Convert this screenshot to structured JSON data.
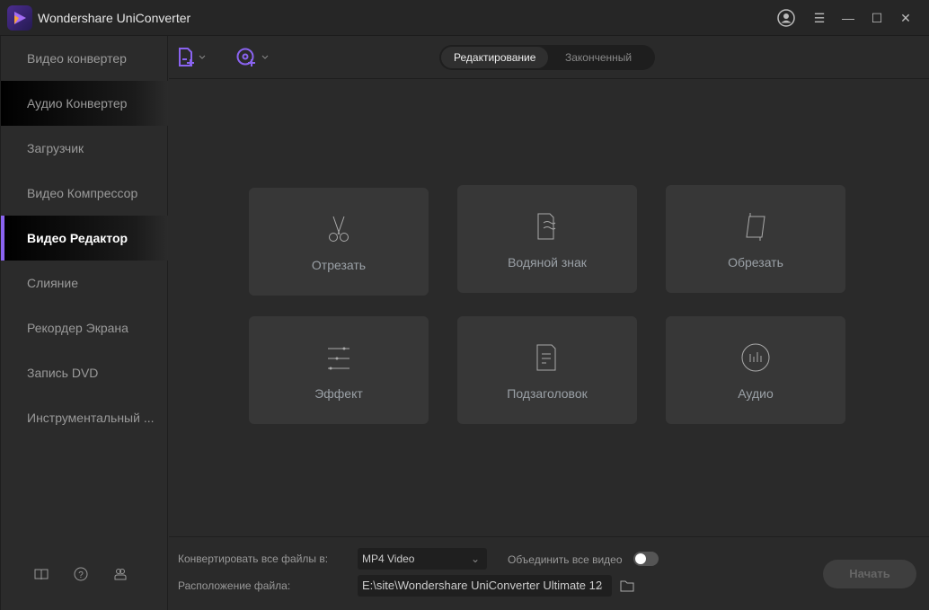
{
  "app": {
    "title": "Wondershare UniConverter"
  },
  "sidebar": {
    "items": [
      {
        "label": "Видео конвертер"
      },
      {
        "label": "Аудио Конвертер"
      },
      {
        "label": "Загрузчик"
      },
      {
        "label": "Видео Компрессор"
      },
      {
        "label": "Видео Редактор"
      },
      {
        "label": "Слияние"
      },
      {
        "label": "Рекордер Экрана"
      },
      {
        "label": "Запись DVD"
      },
      {
        "label": "Инструментальный ..."
      }
    ]
  },
  "tabs": {
    "editing": "Редактирование",
    "finished": "Законченный"
  },
  "tools": [
    {
      "label": "Отрезать",
      "icon": "scissors-icon"
    },
    {
      "label": "Водяной знак",
      "icon": "watermark-icon"
    },
    {
      "label": "Обрезать",
      "icon": "crop-icon"
    },
    {
      "label": "Эффект",
      "icon": "effect-sliders-icon"
    },
    {
      "label": "Подзаголовок",
      "icon": "subtitle-icon"
    },
    {
      "label": "Аудио",
      "icon": "audio-icon"
    }
  ],
  "bottom": {
    "convert_label": "Конвертировать все файлы в:",
    "format": "MP4 Video",
    "merge_label": "Объединить все видео",
    "merge_on": false,
    "location_label": "Расположение файла:",
    "path": "E:\\site\\Wondershare UniConverter Ultimate 12",
    "start": "Начать"
  },
  "colors": {
    "accent": "#8a63f0"
  }
}
